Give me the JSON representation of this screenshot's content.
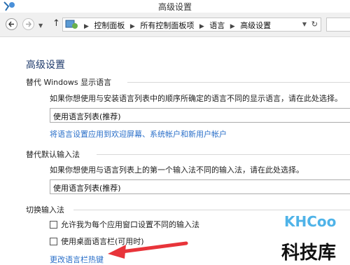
{
  "window": {
    "title": "高级设置"
  },
  "address": {
    "crumbs": [
      "控制面板",
      "所有控制面板项",
      "语言",
      "高级设置"
    ]
  },
  "content": {
    "heading": "高级设置",
    "display_language": {
      "title": "替代 Windows 显示语言",
      "description": "如果你想使用与安装语言列表中的顺序所确定的语言不同的显示语言，请在此处选择。",
      "selected": "使用语言列表(推荐)",
      "link": "将语言设置应用到欢迎屏幕、系统帐户和新用户帐户"
    },
    "input_method": {
      "title": "替代默认输入法",
      "description": "如果你想使用与语言列表上的第一个输入法不同的输入法，请在此处选择。",
      "selected": "使用语言列表(推荐)"
    },
    "switching": {
      "title": "切换输入法",
      "option1": "允许我为每个应用窗口设置不同的输入法",
      "option2": "使用桌面语言栏(可用时)",
      "link": "更改语言栏热键"
    }
  },
  "watermark": {
    "logo": "KHCoo",
    "text": "科技库"
  },
  "colors": {
    "link": "#2a6fc9",
    "heading": "#1e3a6b",
    "arrow": "#e8343a"
  }
}
